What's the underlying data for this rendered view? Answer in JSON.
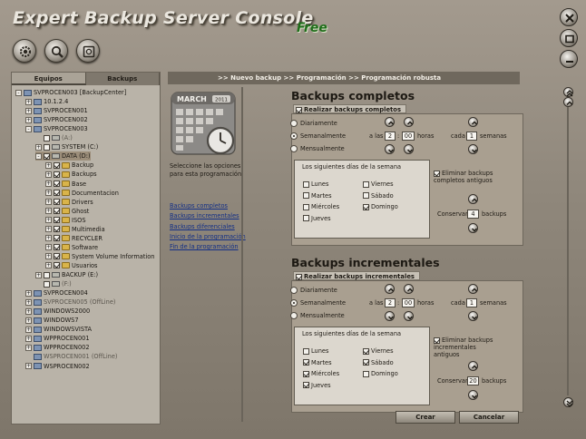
{
  "app": {
    "title": "Expert Backup Server Console",
    "edition": "Free"
  },
  "tabs": [
    {
      "label": "Equipos",
      "active": true
    },
    {
      "label": "Backups",
      "active": false
    }
  ],
  "tree": [
    {
      "label": "SVPROCEN003 [BackupCenter]",
      "level": 0,
      "exp": "-",
      "icon": "pc",
      "check": false
    },
    {
      "label": "10.1.2.4",
      "level": 1,
      "exp": "+",
      "icon": "pc",
      "check": false
    },
    {
      "label": "SVPROCEN001",
      "level": 1,
      "exp": "+",
      "icon": "pc",
      "check": false
    },
    {
      "label": "SVPROCEN002",
      "level": 1,
      "exp": "+",
      "icon": "pc",
      "check": false
    },
    {
      "label": "SVPROCEN003",
      "level": 1,
      "exp": "-",
      "icon": "pc",
      "check": false
    },
    {
      "label": "(A:)",
      "level": 2,
      "exp": "",
      "icon": "drv",
      "check": false,
      "cb": true,
      "off": true
    },
    {
      "label": "SYSTEM (C:)",
      "level": 2,
      "exp": "+",
      "icon": "drv",
      "check": false,
      "cb": true
    },
    {
      "label": "DATA (D:)",
      "level": 2,
      "exp": "-",
      "icon": "drv",
      "check": true,
      "cb": true,
      "sel": true
    },
    {
      "label": "Backup",
      "level": 3,
      "exp": "+",
      "icon": "fold",
      "check": true,
      "cb": true
    },
    {
      "label": "Backups",
      "level": 3,
      "exp": "+",
      "icon": "fold",
      "check": true,
      "cb": true
    },
    {
      "label": "Base",
      "level": 3,
      "exp": "+",
      "icon": "fold",
      "check": true,
      "cb": true
    },
    {
      "label": "Documentacion",
      "level": 3,
      "exp": "+",
      "icon": "fold",
      "check": true,
      "cb": true
    },
    {
      "label": "Drivers",
      "level": 3,
      "exp": "+",
      "icon": "fold",
      "check": true,
      "cb": true
    },
    {
      "label": "Ghost",
      "level": 3,
      "exp": "+",
      "icon": "fold",
      "check": true,
      "cb": true
    },
    {
      "label": "ISOS",
      "level": 3,
      "exp": "+",
      "icon": "fold",
      "check": true,
      "cb": true
    },
    {
      "label": "Multimedia",
      "level": 3,
      "exp": "+",
      "icon": "fold",
      "check": true,
      "cb": true
    },
    {
      "label": "RECYCLER",
      "level": 3,
      "exp": "+",
      "icon": "fold",
      "check": true,
      "cb": true
    },
    {
      "label": "Software",
      "level": 3,
      "exp": "+",
      "icon": "fold",
      "check": true,
      "cb": true
    },
    {
      "label": "System Volume Information",
      "level": 3,
      "exp": "+",
      "icon": "fold",
      "check": true,
      "cb": true
    },
    {
      "label": "Usuarios",
      "level": 3,
      "exp": "+",
      "icon": "fold",
      "check": true,
      "cb": true
    },
    {
      "label": "BACKUP (E:)",
      "level": 2,
      "exp": "+",
      "icon": "drv",
      "check": false,
      "cb": true
    },
    {
      "label": "(F:)",
      "level": 2,
      "exp": "",
      "icon": "drv",
      "check": false,
      "cb": true,
      "off": true
    },
    {
      "label": "SVPROCEN004",
      "level": 1,
      "exp": "+",
      "icon": "pc",
      "check": false
    },
    {
      "label": "SVPROCEN005 (OffLine)",
      "level": 1,
      "exp": "+",
      "icon": "pc",
      "check": false,
      "off": true
    },
    {
      "label": "WINDOWS2000",
      "level": 1,
      "exp": "+",
      "icon": "pc",
      "check": false
    },
    {
      "label": "WINDOWS7",
      "level": 1,
      "exp": "+",
      "icon": "pc",
      "check": false
    },
    {
      "label": "WINDOWSVISTA",
      "level": 1,
      "exp": "+",
      "icon": "pc",
      "check": false
    },
    {
      "label": "WPPROCEN001",
      "level": 1,
      "exp": "+",
      "icon": "pc",
      "check": false
    },
    {
      "label": "WPPROCEN002",
      "level": 1,
      "exp": "+",
      "icon": "pc",
      "check": false
    },
    {
      "label": "WSPROCEN001 (OffLine)",
      "level": 1,
      "exp": "",
      "icon": "pc",
      "check": false,
      "off": true
    },
    {
      "label": "WSPROCEN002",
      "level": 1,
      "exp": "+",
      "icon": "pc",
      "check": false
    }
  ],
  "breadcrumb": ">> Nuevo backup >> Programación >> Programación robusta",
  "calendar": {
    "month": "MARCH",
    "year": "2011"
  },
  "side": {
    "description": "Seleccione las opciones para esta programación",
    "links": [
      "Backups completos",
      "Backups incrementales",
      "Backups diferenciales",
      "Inicio de la programación",
      "Fin de la programación"
    ]
  },
  "full": {
    "title": "Backups completos",
    "enable_label": "Realizar backups completos",
    "enabled": true,
    "opt_daily": "Diariamente",
    "opt_weekly": "Semanalmente",
    "opt_monthly": "Mensualmente",
    "selected": "weekly",
    "at": "a las",
    "hour": "2",
    "minute": "00",
    "hours_label": "horas",
    "every": "cada",
    "every_value": "1",
    "weeks_label": "semanas",
    "days_title": "Los siguientes días de la semana",
    "days": [
      {
        "label": "Lunes",
        "checked": false
      },
      {
        "label": "Martes",
        "checked": false
      },
      {
        "label": "Miércoles",
        "checked": false
      },
      {
        "label": "Jueves",
        "checked": false
      },
      {
        "label": "Viernes",
        "checked": false
      },
      {
        "label": "Sábado",
        "checked": false
      },
      {
        "label": "Domingo",
        "checked": true
      }
    ],
    "delete_old": "Eliminar backups completos antiguos",
    "delete_checked": true,
    "keep": "Conservar",
    "keep_value": "4",
    "keep_unit": "backups"
  },
  "incr": {
    "title": "Backups incrementales",
    "enable_label": "Realizar backups incrementales",
    "enabled": true,
    "opt_daily": "Diariamente",
    "opt_weekly": "Semanalmente",
    "opt_monthly": "Mensualmente",
    "selected": "weekly",
    "at": "a las",
    "hour": "2",
    "minute": "00",
    "hours_label": "horas",
    "every": "cada",
    "every_value": "1",
    "weeks_label": "semanas",
    "days_title": "Los siguientes días de la semana",
    "days": [
      {
        "label": "Lunes",
        "checked": false
      },
      {
        "label": "Martes",
        "checked": true
      },
      {
        "label": "Miércoles",
        "checked": true
      },
      {
        "label": "Jueves",
        "checked": true
      },
      {
        "label": "Viernes",
        "checked": true
      },
      {
        "label": "Sábado",
        "checked": true
      },
      {
        "label": "Domingo",
        "checked": false
      }
    ],
    "delete_old": "Eliminar backups incrementales antiguos",
    "delete_checked": true,
    "keep": "Conservar",
    "keep_value": "20",
    "keep_unit": "backups"
  },
  "actions": {
    "create": "Crear",
    "cancel": "Cancelar"
  },
  "colors": {
    "background": "#8f877b",
    "panel": "#a99f90",
    "link": "#132f86",
    "free": "#1f6e1a"
  }
}
